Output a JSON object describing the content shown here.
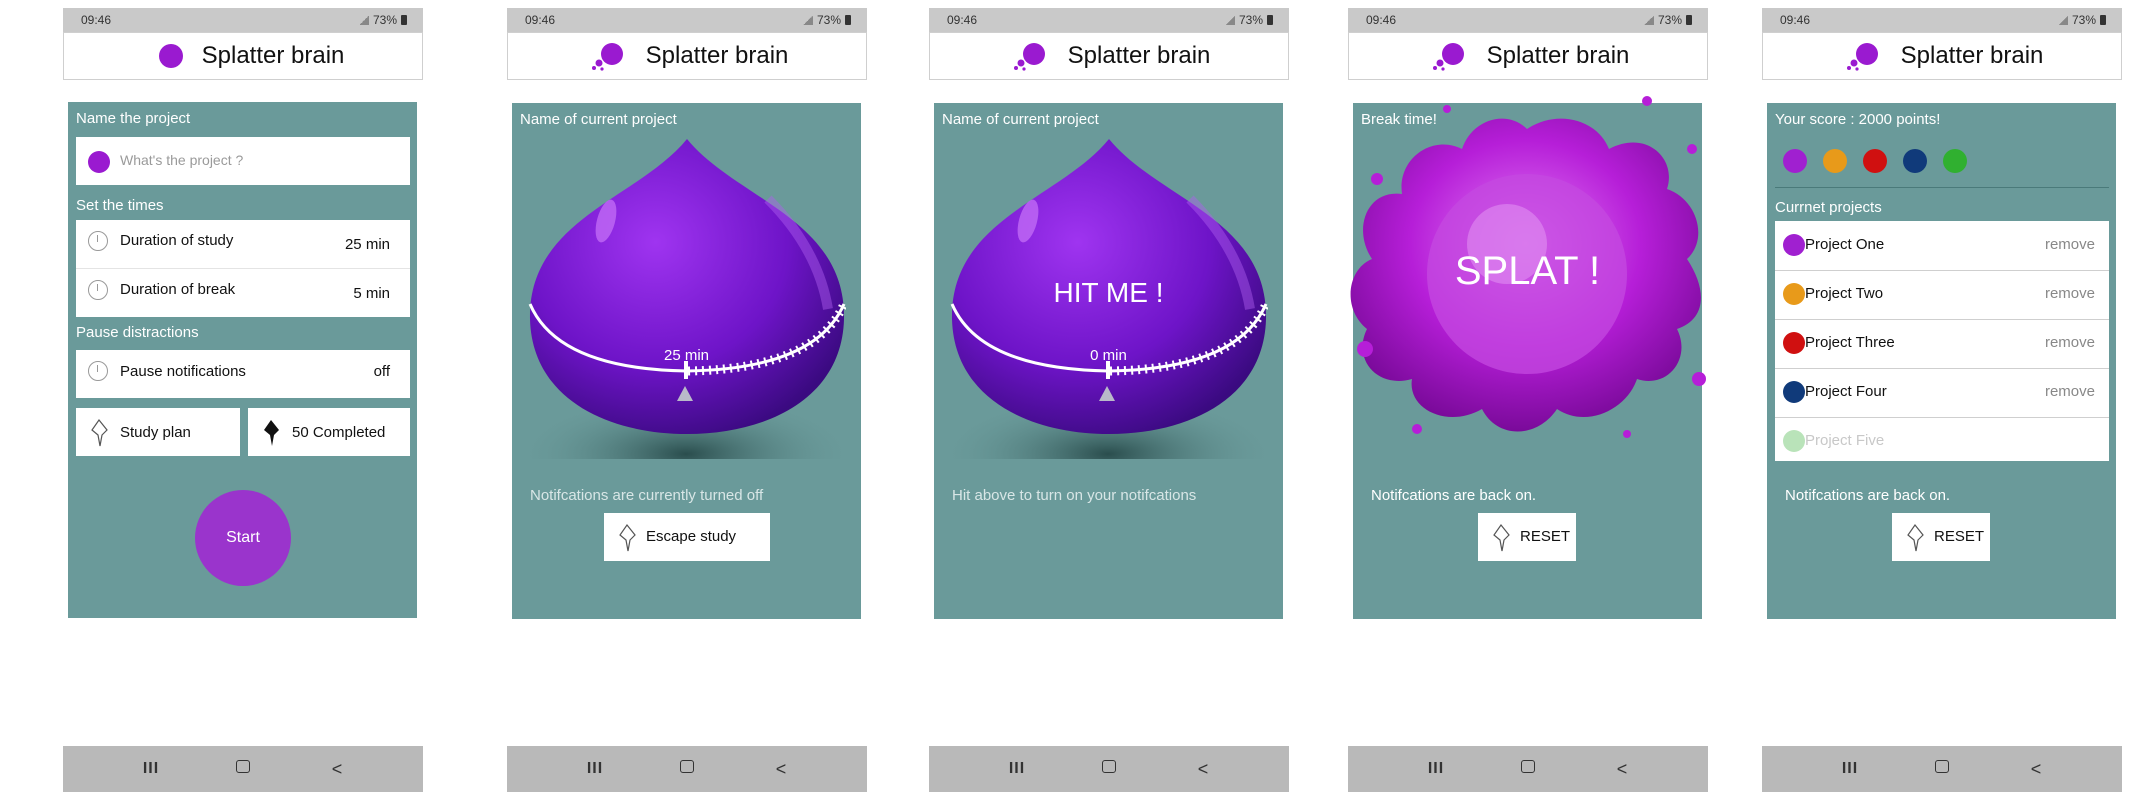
{
  "status": {
    "time": "09:46",
    "battery": "73%"
  },
  "app": {
    "title": "Splatter brain"
  },
  "nav": {
    "recent": "III",
    "back": "<"
  },
  "screen1": {
    "name_section": "Name the project",
    "name_placeholder": "What's the project ?",
    "times_section": "Set the times",
    "study_label": "Duration of study",
    "study_value": "25 min",
    "break_label": "Duration of break",
    "break_value": "5 min",
    "distractions_section": "Pause distractions",
    "notifications_label": "Pause notifications",
    "notifications_value": "off",
    "study_plan_label": "Study plan",
    "completed_label": "50 Completed",
    "start_label": "Start"
  },
  "screen2": {
    "header": "Name of current project",
    "timer_value": "25 min",
    "note": "Notifcations are currently turned off",
    "escape_label": "Escape study"
  },
  "screen3": {
    "header": "Name of current project",
    "hit_label": "HIT ME !",
    "timer_value": "0 min",
    "note": "Hit above to turn on your notifcations"
  },
  "screen4": {
    "header": "Break time!",
    "splat_label": "SPLAT !",
    "note": "Notifcations are back on.",
    "reset_label": "RESET"
  },
  "screen5": {
    "score": "Your score : 2000 points!",
    "score_colors": [
      "#a020d0",
      "#e89a1a",
      "#d01010",
      "#103a7a",
      "#30b030"
    ],
    "projects_section": "Currnet projects",
    "projects": [
      {
        "name": "Project One",
        "action": "remove",
        "color": "#a020d0"
      },
      {
        "name": "Project Two",
        "action": "remove",
        "color": "#e89a1a"
      },
      {
        "name": "Project Three",
        "action": "remove",
        "color": "#d01010"
      },
      {
        "name": "Project Four",
        "action": "remove",
        "color": "#103a7a"
      },
      {
        "name": "Project Five",
        "action": "",
        "color": "#8ad08a"
      }
    ],
    "note": "Notifcations are back on.",
    "reset_label": "RESET"
  },
  "colors": {
    "accent": "#9a34cc",
    "panel": "#6a9a9a",
    "statusbar": "#c9c9c9",
    "navbar": "#b9b9b9"
  }
}
